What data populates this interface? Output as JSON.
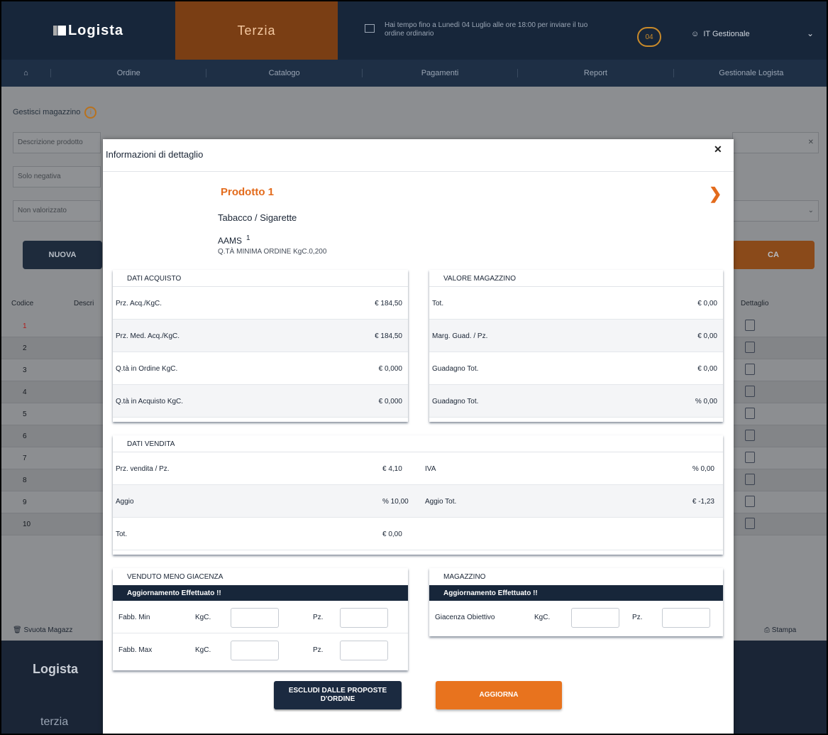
{
  "app": {
    "brand": "Logista",
    "partner": "Terzia",
    "notice": "Hai tempo fino a Lunedì 04 Luglio alle ore 18:00 per inviare il tuo ordine ordinario",
    "badge": "04",
    "user": "IT Gestionale",
    "nav": [
      "Ordine",
      "Catalogo",
      "Pagamenti",
      "Report",
      "Gestionale Logista"
    ],
    "page_title": "Gestisci magazzino",
    "search_placeholder": "Descrizione prodotto",
    "filter_negative": "Solo negativa",
    "filter_value": "Non valorizzato",
    "new_button": "NUOVA",
    "search_button": "CA",
    "columns": [
      "Codice",
      "Descri",
      "Dettaglio"
    ],
    "rows": [
      "1",
      "2",
      "3",
      "4",
      "5",
      "6",
      "7",
      "8",
      "9",
      "10"
    ],
    "empty_button": "Svuota Magazz",
    "print_button": "Stampa",
    "footer_brand": "Logista",
    "footer_partner": "terzia"
  },
  "modal": {
    "title": "Informazioni di dettaglio",
    "product_name": "Prodotto 1",
    "category": "Tabacco / Sigarette",
    "aams_label": "AAMS",
    "aams_value": "1",
    "min_order": "Q.TÀ MINIMA ORDINE KgC.0,200",
    "purchase": {
      "title": "DATI ACQUISTO",
      "rows": [
        {
          "label": "Prz. Acq./KgC.",
          "value": "€ 184,50"
        },
        {
          "label": "Prz. Med. Acq./KgC.",
          "value": "€ 184,50"
        },
        {
          "label": "Q.tà in Ordine KgC.",
          "value": "€ 0,000"
        },
        {
          "label": "Q.tà in Acquisto KgC.",
          "value": "€ 0,000"
        }
      ]
    },
    "stock_value": {
      "title": "VALORE MAGAZZINO",
      "rows": [
        {
          "label": "Tot.",
          "value": "€ 0,00"
        },
        {
          "label": "Marg. Guad. / Pz.",
          "value": "€ 0,00"
        },
        {
          "label": "Guadagno Tot.",
          "value": "€ 0,00"
        },
        {
          "label": "Guadagno Tot.",
          "value": "% 0,00"
        }
      ]
    },
    "sales": {
      "title": "DATI VENDITA",
      "rows": [
        {
          "label": "Prz. vendita / Pz.",
          "value": "€ 4,10",
          "label2": "IVA",
          "value2": "% 0,00"
        },
        {
          "label": "Aggio",
          "value": "% 10,00",
          "label2": "Aggio Tot.",
          "value2": "€ -1,23"
        },
        {
          "label": "Tot.",
          "value": "€ 0,00",
          "label2": "",
          "value2": ""
        }
      ]
    },
    "sold_less_stock": {
      "title": "VENDUTO MENO GIACENZA",
      "bar": "Aggiornamento Effettuato !!",
      "rows": [
        {
          "label": "Fabb. Min",
          "unit1": "KgC.",
          "unit2": "Pz."
        },
        {
          "label": "Fabb. Max",
          "unit1": "KgC.",
          "unit2": "Pz."
        }
      ]
    },
    "warehouse": {
      "title": "MAGAZZINO",
      "bar": "Aggiornamento Effettuato !!",
      "label": "Giacenza Obiettivo",
      "unit1": "KgC.",
      "unit2": "Pz."
    },
    "exclude_button": "ESCLUDI DALLE PROPOSTE D'ORDINE",
    "update_button": "AGGIORNA"
  }
}
